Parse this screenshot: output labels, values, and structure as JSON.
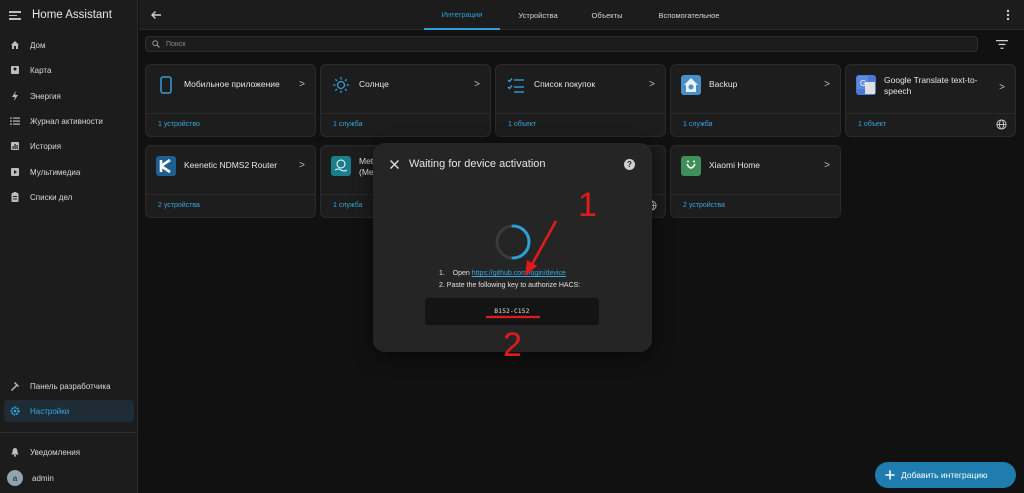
{
  "app": {
    "title": "Home Assistant"
  },
  "sidebar": {
    "items": [
      {
        "label": "Дом",
        "icon": "home-icon"
      },
      {
        "label": "Карта",
        "icon": "map-icon"
      },
      {
        "label": "Энергия",
        "icon": "lightning-icon"
      },
      {
        "label": "Журнал активности",
        "icon": "list-icon"
      },
      {
        "label": "История",
        "icon": "chart-icon"
      },
      {
        "label": "Мультимедиа",
        "icon": "media-icon"
      },
      {
        "label": "Списки дел",
        "icon": "clipboard-icon"
      }
    ],
    "bottom": [
      {
        "label": "Панель разработчика",
        "icon": "hammer-icon"
      },
      {
        "label": "Настройки",
        "icon": "gear-icon",
        "active": true
      }
    ],
    "notifications": "Уведомления",
    "user": {
      "initial": "a",
      "name": "admin"
    }
  },
  "topbar": {
    "tabs": [
      "Интеграции",
      "Устройства",
      "Объекты",
      "Вспомогательное"
    ],
    "active_tab": "Интеграции"
  },
  "search": {
    "placeholder": "Поиск"
  },
  "cards": [
    {
      "name": "Мобильное приложение",
      "link": "1 устройство",
      "icon": "mobile-phone-icon"
    },
    {
      "name": "Солнце",
      "link": "1 служба",
      "icon": "sun-icon"
    },
    {
      "name": "Список покупок",
      "link": "1 объект",
      "icon": "checklist-icon"
    },
    {
      "name": "Backup",
      "link": "1 служба",
      "icon": "backup-house-icon"
    },
    {
      "name": "Google Translate text-to-speech",
      "link": "1 объект",
      "icon": "google-translate-icon",
      "cloud": true
    },
    {
      "name": "Keenetic NDMS2 Router",
      "link": "2 устройства",
      "icon": "keenetic-logo-icon"
    },
    {
      "name": "Met",
      "name_line2": "(Me",
      "link": "1 служба",
      "icon": "met-logo-icon"
    },
    {
      "name": "",
      "link": "",
      "icon": "globe-icon",
      "cloud": true
    },
    {
      "name": "Xiaomi Home",
      "link": "2 устройства",
      "icon": "xiaomi-home-icon"
    }
  ],
  "dialog": {
    "title": "Waiting for device activation",
    "step1_num": "1.",
    "step1_prefix": "Open",
    "step1_link": "https://github.com/login/device",
    "step2": "2. Paste the following key to authorize HACS:",
    "code": "B152-C152"
  },
  "annotations": {
    "marker1": "1",
    "marker2": "2",
    "color": "#e01b1b"
  },
  "fab": {
    "label": "Добавить интеграцию"
  },
  "colors": {
    "accent": "#2f9fd8",
    "background": "#111111",
    "surface": "#1d1d1d",
    "fab": "#1f7cae"
  }
}
